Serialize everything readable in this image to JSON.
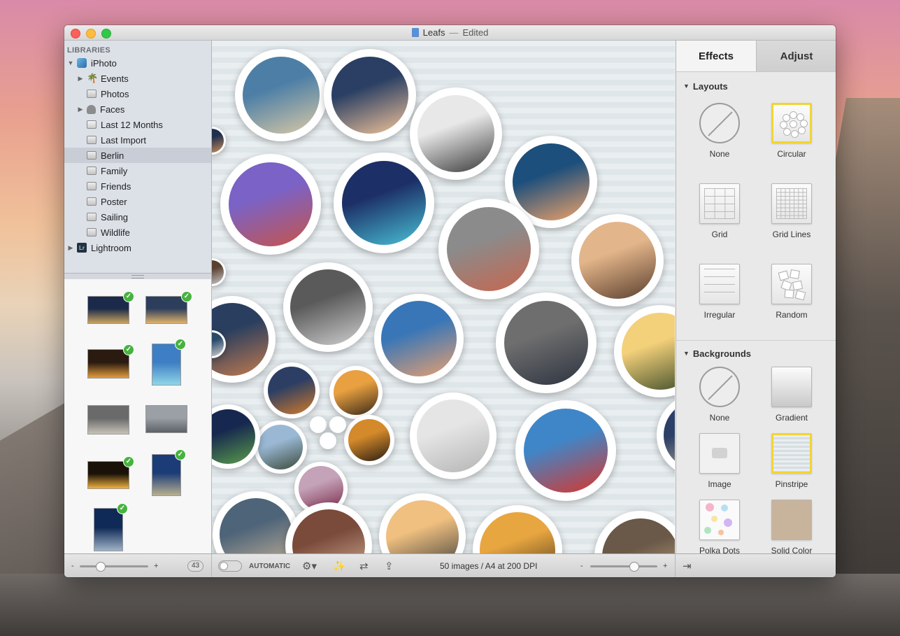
{
  "window": {
    "title": "Leafs",
    "status": "Edited",
    "title_separator": "—"
  },
  "sidebar": {
    "libraries_header": "LIBRARIES",
    "items": [
      {
        "label": "iPhoto",
        "disclosure": "▼",
        "icon": "iphoto-app-icon",
        "indent": 0
      },
      {
        "label": "Events",
        "disclosure": "▶",
        "icon": "palm-icon",
        "indent": 1
      },
      {
        "label": "Photos",
        "disclosure": "",
        "icon": "album-icon",
        "indent": 1
      },
      {
        "label": "Faces",
        "disclosure": "▶",
        "icon": "face-icon",
        "indent": 1
      },
      {
        "label": "Last 12 Months",
        "disclosure": "",
        "icon": "calendar-icon",
        "indent": 1
      },
      {
        "label": "Last Import",
        "disclosure": "",
        "icon": "album-icon",
        "indent": 1
      },
      {
        "label": "Berlin",
        "disclosure": "",
        "icon": "album-icon",
        "indent": 1,
        "selected": true
      },
      {
        "label": "Family",
        "disclosure": "",
        "icon": "album-icon",
        "indent": 1
      },
      {
        "label": "Friends",
        "disclosure": "",
        "icon": "album-icon",
        "indent": 1
      },
      {
        "label": "Poster",
        "disclosure": "",
        "icon": "album-icon",
        "indent": 1
      },
      {
        "label": "Sailing",
        "disclosure": "",
        "icon": "album-icon",
        "indent": 1
      },
      {
        "label": "Wildlife",
        "disclosure": "",
        "icon": "album-icon",
        "indent": 1
      },
      {
        "label": "Lightroom",
        "disclosure": "▶",
        "icon": "lightroom-app-icon",
        "indent": 0
      }
    ],
    "lightroom_badge": "Lr",
    "thumbnails": [
      {
        "checked": true,
        "colors": [
          "#1b2a4a",
          "#c9a35e"
        ]
      },
      {
        "checked": true,
        "colors": [
          "#2d3e5c",
          "#e0b36a"
        ]
      },
      {
        "checked": true,
        "colors": [
          "#2a1a10",
          "#e39c3d"
        ]
      },
      {
        "checked": true,
        "colors": [
          "#3e7ec4",
          "#8fd6e8"
        ]
      },
      {
        "checked": false,
        "colors": [
          "#6a6a6a",
          "#c7c2b8"
        ]
      },
      {
        "checked": false,
        "colors": [
          "#9aa0a6",
          "#5d6268"
        ]
      },
      {
        "checked": true,
        "colors": [
          "#1a1208",
          "#f0b03e"
        ]
      },
      {
        "checked": true,
        "colors": [
          "#1c3c78",
          "#b7b08e"
        ]
      },
      {
        "checked": true,
        "colors": [
          "#0f2a56",
          "#9fb2c6"
        ]
      }
    ]
  },
  "canvas": {
    "bubbles": [
      {
        "colors": [
          "#4d7fa6",
          "#d9c9a6"
        ]
      },
      {
        "colors": [
          "#2a3f63",
          "#f2c49a"
        ]
      },
      {
        "colors": [
          "#e8e8e8",
          "#3a3a3a"
        ]
      },
      {
        "colors": [
          "#1d4f7c",
          "#f0a36a"
        ]
      },
      {
        "colors": [
          "#7a62c6",
          "#c6544a"
        ]
      },
      {
        "colors": [
          "#1c2f66",
          "#49c2d6"
        ]
      },
      {
        "colors": [
          "#8b8b8b",
          "#c8664e"
        ]
      },
      {
        "colors": [
          "#e3b58a",
          "#5a3f2e"
        ]
      },
      {
        "colors": [
          "#5a5a5a",
          "#cfcfcf"
        ]
      },
      {
        "colors": [
          "#2a3f5f",
          "#c37a4e"
        ]
      },
      {
        "colors": [
          "#3876b8",
          "#e8a070"
        ]
      },
      {
        "colors": [
          "#6e6e6e",
          "#2d3340"
        ]
      },
      {
        "colors": [
          "#f3d07a",
          "#3a4a28"
        ]
      },
      {
        "colors": [
          "#2c3e63",
          "#d17a2a"
        ]
      },
      {
        "colors": [
          "#e8a040",
          "#3a2a1a"
        ]
      },
      {
        "colors": [
          "#e5e5e5",
          "#b5b5b5"
        ]
      },
      {
        "colors": [
          "#d48a2a",
          "#2a1d14"
        ]
      },
      {
        "colors": [
          "#9ab8d4",
          "#3a4a3a"
        ]
      },
      {
        "colors": [
          "#3f86c8",
          "#d9362c"
        ]
      },
      {
        "colors": [
          "#2c3f66",
          "#c5b89a"
        ]
      },
      {
        "colors": [
          "#16284f",
          "#5a9c4a"
        ]
      },
      {
        "colors": [
          "#c4a2b8",
          "#7b2a4a"
        ]
      },
      {
        "colors": [
          "#4e6478",
          "#c8b49a"
        ]
      },
      {
        "colors": [
          "#7a4a3a",
          "#d8b8a0"
        ]
      },
      {
        "colors": [
          "#f0c080",
          "#3a3a3a"
        ]
      },
      {
        "colors": [
          "#e8a640",
          "#3a2a1a"
        ]
      },
      {
        "colors": [
          "#6a5848",
          "#d0b890"
        ]
      },
      {
        "colors": [
          "#1f2f4e",
          "#c98e5a"
        ]
      },
      {
        "colors": [
          "#5a4030",
          "#c8c8c8"
        ]
      },
      {
        "colors": [
          "#2a4a6a",
          "#d0d0d0"
        ]
      },
      {
        "colors": [
          "#ffffff",
          "#eeeeee"
        ]
      },
      {
        "colors": [
          "#ffffff",
          "#eeeeee"
        ]
      },
      {
        "colors": [
          "#ffffff",
          "#eeeeee"
        ]
      }
    ]
  },
  "rpanel": {
    "tabs": [
      {
        "label": "Effects",
        "active": true
      },
      {
        "label": "Adjust",
        "active": false
      }
    ],
    "layouts_header": "Layouts",
    "layouts": [
      {
        "label": "None",
        "icon": "none-icon",
        "selected": false
      },
      {
        "label": "Circular",
        "icon": "circular-layout-icon",
        "selected": true
      },
      {
        "label": "Grid",
        "icon": "grid-layout-icon",
        "selected": false
      },
      {
        "label": "Grid Lines",
        "icon": "grid-lines-layout-icon",
        "selected": false
      },
      {
        "label": "Irregular",
        "icon": "irregular-layout-icon",
        "selected": false
      },
      {
        "label": "Random",
        "icon": "random-layout-icon",
        "selected": false
      }
    ],
    "backgrounds_header": "Backgrounds",
    "backgrounds": [
      {
        "label": "None",
        "icon": "none-icon",
        "selected": false
      },
      {
        "label": "Gradient",
        "icon": "gradient-background-icon",
        "selected": false
      },
      {
        "label": "Image",
        "icon": "camera-icon",
        "selected": false
      },
      {
        "label": "Pinstripe",
        "icon": "pinstripe-background-icon",
        "selected": true
      },
      {
        "label": "Polka Dots",
        "icon": "polka-dots-background-icon",
        "selected": false
      },
      {
        "label": "Solid Color",
        "icon": "solid-color-background-icon",
        "selected": false
      }
    ],
    "solid_color": "#c8b49c"
  },
  "bottombar": {
    "zoom_minus": "-",
    "zoom_plus": "+",
    "thumb_count": "43",
    "automatic_label": "AUTOMATIC",
    "status_text": "50 images / A4 at 200 DPI",
    "canvas_zoom_minus": "-",
    "canvas_zoom_plus": "+",
    "thumb_zoom_value": 0.3,
    "canvas_zoom_value": 0.65
  }
}
